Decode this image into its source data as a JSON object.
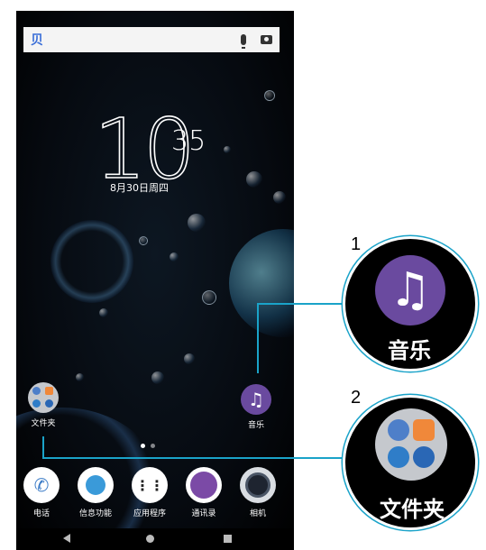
{
  "search": {
    "logo": "贝"
  },
  "clock": {
    "hour": "10",
    "minute": "35",
    "date": "8月30日周四"
  },
  "home_apps": {
    "folder_label": "文件夹",
    "music_label": "音乐"
  },
  "dock": [
    {
      "label": "电话",
      "icon": "phone-icon",
      "color": "#3c7cc7"
    },
    {
      "label": "信息功能",
      "icon": "messaging-icon",
      "color": "#3a9ad9"
    },
    {
      "label": "应用程序",
      "icon": "app-drawer-icon",
      "color": "#ffffff"
    },
    {
      "label": "通讯录",
      "icon": "contacts-icon",
      "color": "#7b4aa6"
    },
    {
      "label": "相机",
      "icon": "camera-icon",
      "color": "#1e2430"
    }
  ],
  "callouts": [
    {
      "number": "1",
      "label": "音乐",
      "icon": "music-note-icon"
    },
    {
      "number": "2",
      "label": "文件夹",
      "icon": "folder-icon"
    }
  ],
  "colors": {
    "accent_line": "#1aa3c9",
    "music": "#6a4a9f"
  }
}
